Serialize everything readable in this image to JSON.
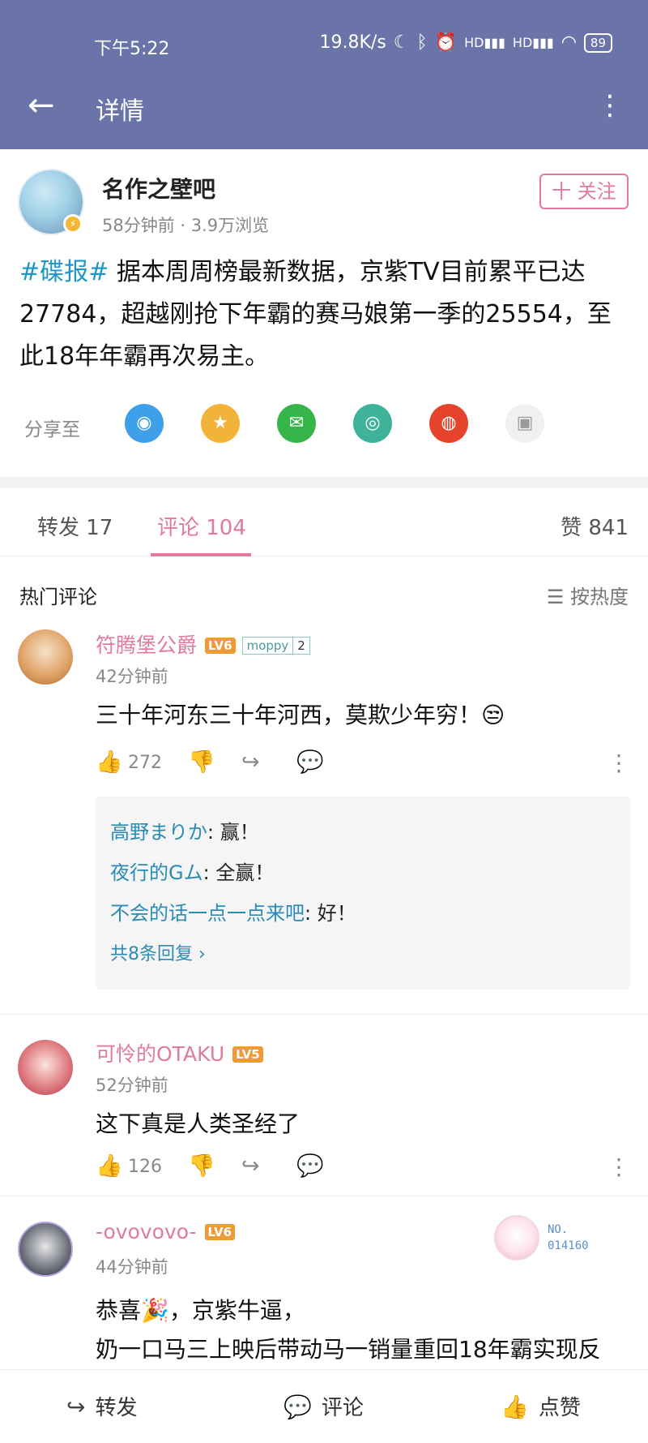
{
  "status_bar": {
    "time": "下午5:22",
    "net_speed": "19.8K/s",
    "battery": "89",
    "signal_label_1": "HD",
    "signal_label_2": "HD"
  },
  "header": {
    "title": "详情",
    "back_icon": "arrow-left-icon",
    "more_icon": "more-vertical-icon"
  },
  "post": {
    "author": "名作之壁吧",
    "meta": "58分钟前 · 3.9万浏览",
    "follow_label": "十 关注",
    "tag": "#碟报#",
    "body": " 据本周周榜最新数据，京紫TV目前累平已达27784，超越刚抢下年霸的赛马娘第一季的25554，至此18年年霸再次易主。"
  },
  "share": {
    "label": "分享至",
    "targets": [
      {
        "icon": "qq-icon",
        "color": "#3ea0e8"
      },
      {
        "icon": "qzone-icon",
        "color": "#f2b33a"
      },
      {
        "icon": "wechat-icon",
        "color": "#38b54a"
      },
      {
        "icon": "moments-icon",
        "color": "#3fb39a"
      },
      {
        "icon": "weibo-icon",
        "color": "#e5432c"
      },
      {
        "icon": "image-icon",
        "color": "#f0f0f0"
      }
    ]
  },
  "tabs": {
    "repost": "转发 17",
    "comments": "评论 104",
    "likes": "赞 841"
  },
  "comments_header": {
    "title": "热门评论",
    "sort": "☰ 按热度"
  },
  "comments": [
    {
      "user": "符腾堡公爵",
      "level": "LV6",
      "medal_name": "moppy",
      "medal_level": "2",
      "time": "42分钟前",
      "text": "三十年河东三十年河西，莫欺少年穷！😒",
      "likes": "272",
      "replies": [
        {
          "name": "高野まりか",
          "text": ": 赢！"
        },
        {
          "name": "夜行的Gム",
          "text": ": 全赢！"
        },
        {
          "name": "不会的话一点一点来吧",
          "text": ": 好！"
        }
      ],
      "reply_more": "共8条回复 ›"
    },
    {
      "user": "可怜的OTAKU",
      "level": "LV5",
      "time": "52分钟前",
      "text": "这下真是人类圣经了",
      "likes": "126"
    },
    {
      "user": "-ovovovo-",
      "level": "LV6",
      "time": "44分钟前",
      "text_line1": "恭喜🎉，京紫牛逼，",
      "text_line2": "奶一口马三上映后带动马一销量重回18年霸实现反",
      "badge_no": "NO.",
      "badge_num": "014160"
    }
  ],
  "bottom_bar": {
    "repost": "转发",
    "comment": "评论",
    "like": "点赞"
  }
}
